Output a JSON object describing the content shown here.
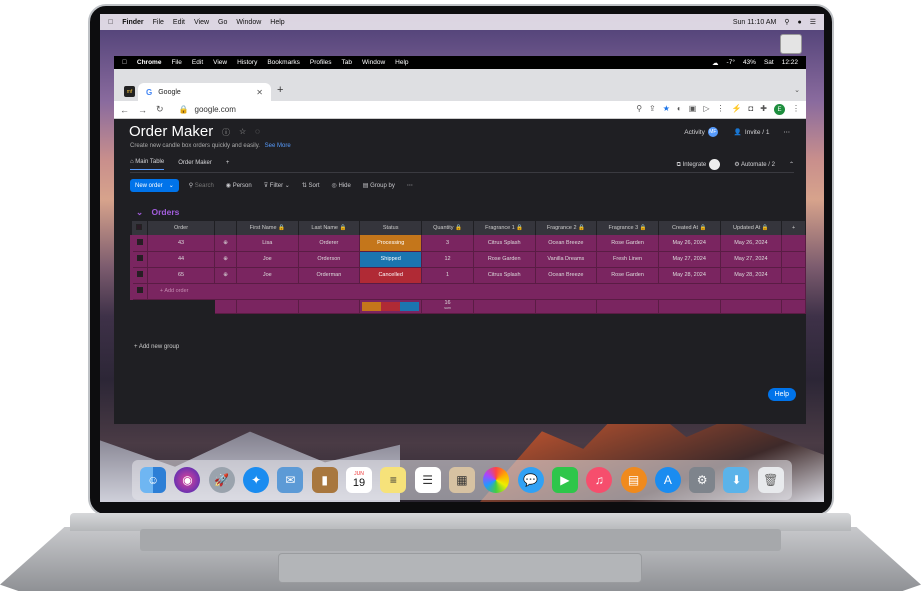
{
  "mac": {
    "apple": "",
    "menus": [
      "Finder",
      "File",
      "Edit",
      "View",
      "Go",
      "Window",
      "Help"
    ],
    "clock": "Sun 11:10 AM"
  },
  "chrome": {
    "menus": [
      "Chrome",
      "File",
      "Edit",
      "View",
      "History",
      "Bookmarks",
      "Profiles",
      "Tab",
      "Window",
      "Help"
    ],
    "status_right": [
      "-7°",
      "43%",
      "Sat",
      "12:22"
    ],
    "tab_title": "Google",
    "url": "google.com",
    "profile_initial": "E"
  },
  "app": {
    "title": "Order Maker",
    "subtitle": "Create new candle box orders quickly and easily.",
    "see_more": "See More",
    "activity": "Activity",
    "activity_avatar": "MF",
    "invite": "Invite / 1",
    "tabs": [
      "Main Table",
      "Order Maker"
    ],
    "integrate": "Integrate",
    "automate": "Automate / 2",
    "toolbar": {
      "new_item": "New order",
      "search": "Search",
      "person": "Person",
      "filter": "Filter",
      "sort": "Sort",
      "hide": "Hide",
      "group_by": "Group by"
    },
    "group_title": "Orders",
    "columns": [
      "Order",
      "First Name",
      "Last Name",
      "Status",
      "Quantity",
      "Fragrance 1",
      "Fragrance 2",
      "Fragrance 3",
      "Created At",
      "Updated At"
    ],
    "rows": [
      {
        "order": "43",
        "first": "Lisa",
        "last": "Orderer",
        "status": "Processing",
        "qty": "3",
        "f1": "Citrus Splash",
        "f2": "Ocean Breeze",
        "f3": "Rose Garden",
        "created": "May 26, 2024",
        "updated": "May 26, 2024"
      },
      {
        "order": "44",
        "first": "Joe",
        "last": "Orderson",
        "status": "Shipped",
        "qty": "12",
        "f1": "Rose Garden",
        "f2": "Vanilla Dreams",
        "f3": "Fresh Linen",
        "created": "May 27, 2024",
        "updated": "May 27, 2024"
      },
      {
        "order": "65",
        "first": "Joe",
        "last": "Orderman",
        "status": "Cancelled",
        "qty": "1",
        "f1": "Citrus Splash",
        "f2": "Ocean Breeze",
        "f3": "Rose Garden",
        "created": "May 28, 2024",
        "updated": "May 28, 2024"
      }
    ],
    "add_row": "+ Add order",
    "sum_value": "16",
    "sum_label": "sum",
    "add_group": "Add new group",
    "help": "Help",
    "status_colors": {
      "Processing": "#c4761b",
      "Shipped": "#1b75b0",
      "Cancelled": "#b02a35"
    }
  },
  "dock_apps": [
    "finder-icon",
    "siri-icon",
    "launchpad-icon",
    "safari-icon",
    "preview-icon",
    "contacts-icon",
    "calendar-icon",
    "notes-icon",
    "reminders-icon",
    "photo-booth-icon",
    "photos-icon",
    "messages-icon",
    "facetime-icon",
    "music-icon",
    "books-icon",
    "app-store-icon",
    "system-preferences-icon",
    "downloads-icon",
    "trash-icon"
  ],
  "calendar_day": "19",
  "calendar_month": "JUN"
}
